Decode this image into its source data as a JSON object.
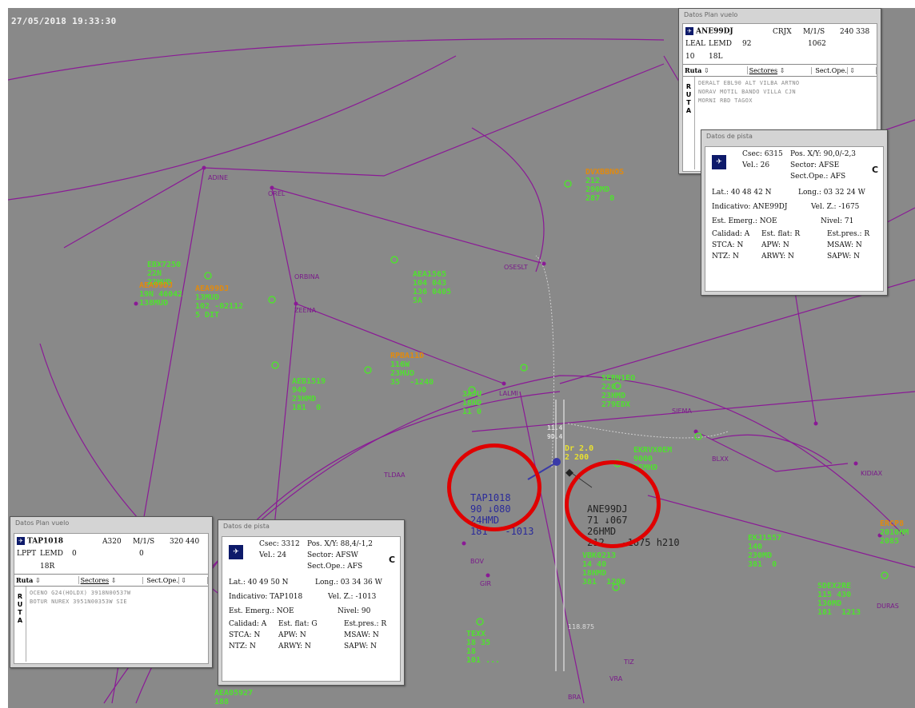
{
  "timestamp": "27/05/2018 19:33:30",
  "colors": {
    "scope_bg": "#898989",
    "route_line": "#8a1a96",
    "track_green": "#50e030",
    "track_orange": "#e08a10",
    "highlight_ring": "#e00000"
  },
  "fixes": [
    "ADINE",
    "OREL",
    "OSESLT",
    "ORBINA",
    "ZEENA",
    "LALMI",
    "TLDAA",
    "SIEMA",
    "BLXX",
    "KIDIAX",
    "BOV",
    "GIR",
    "DURAS",
    "VRA",
    "TIZ",
    "BRA",
    "118.875"
  ],
  "traffic": {
    "t1": [
      "EBX7250",
      "22N",
      "22HUD"
    ],
    "t2": [
      "AEA99DJ",
      "19N 46042",
      "138MUD"
    ],
    "t3": [
      "AEA99DJ",
      "13MUD",
      "102 -02112",
      "5 DIT"
    ],
    "t4": [
      "DVXBBNOS",
      "212",
      "290MD",
      "287  0"
    ],
    "t5": [
      "AEA1565",
      "104 043",
      "136 0405",
      "5A"
    ],
    "t6": [
      "RPBA11D",
      "116W",
      "23HUD",
      "35  -1240"
    ],
    "t7": [
      "AEB1519",
      "940",
      "23HMD",
      "181  0"
    ],
    "t8": [
      "SERN1EO",
      "220",
      "23HMD",
      "279EDX"
    ],
    "t9": [
      "3AJU",
      "18HD",
      "11 0"
    ],
    "t10": [
      "EKRVX0EM",
      "9000",
      "2EMHD"
    ],
    "t11": [
      "EKJ1557",
      "140",
      "230MD",
      "381  0"
    ],
    "t12": [
      "VBK0213",
      "14 40",
      "18HMD",
      "381  1200"
    ],
    "t13": [
      "SDEX2RE",
      "115 430",
      "130MD",
      "181  1213"
    ],
    "t14": [
      "TEXX",
      "18 35",
      "18",
      "101 ..."
    ],
    "t15": [
      "AEA05927",
      "188"
    ],
    "t16": [
      "ERCP8",
      "2010HM",
      "2085"
    ],
    "t17": [
      "Dr 2.0",
      "2 200"
    ],
    "t18": [
      "11.4",
      "9D.4"
    ]
  },
  "tap_label": [
    "TAP1018",
    "90 ↓080",
    "24HMD",
    "181   -1013"
  ],
  "ane_label": [
    "ANE99DJ",
    "71 ↓067",
    "26HMD",
    "212   -1675 h210"
  ],
  "flight_plan_top": {
    "title": "Datos Plan vuelo",
    "callsign": "ANE99DJ",
    "type": "CRJX",
    "wake": "M/1/S",
    "speeds": "240 338",
    "origin": "LEAL",
    "dest": "LEMD",
    "f1": "92",
    "f2": "1062",
    "f3": "10",
    "f4": "18L",
    "ruta_label": "Ruta",
    "sectores_label": "Sectores",
    "sect_ope_label": "Sect.Ope.",
    "ruta_vertical": [
      "R",
      "U",
      "T",
      "A"
    ],
    "route_lines": [
      "DERALT EBL90 ALT VILBA ARTNO",
      "NORAV MOTIL BANDO VILLA CJN",
      "MORNI RBD TAGOX"
    ]
  },
  "track_top": {
    "title": "Datos de pista",
    "csec": "Csec: 6315",
    "pos": "Pos. X/Y: 90,0/-2,3",
    "vel": "Vel.: 26",
    "sector": "Sector: AFSE",
    "sect_ope": "Sect.Ope.: AFS",
    "c": "C",
    "lat": "Lat.: 40 48 42 N",
    "long": "Long.: 03 32 24 W",
    "indicativo": "Indicativo: ANE99DJ",
    "velz": "Vel. Z.: -1675",
    "emerg": "Est. Emerg.: NOE",
    "nivel": "Nivel: 71",
    "calidad": "Calidad: A",
    "est_flat": "Est. flat: R",
    "est_pres": "Est.pres.: R",
    "stca": "STCA: N",
    "apw": "APW: N",
    "msaw": "MSAW: N",
    "ntz": "NTZ: N",
    "arwy": "ARWY: N",
    "sapw": "SAPW: N"
  },
  "flight_plan_bottom": {
    "title": "Datos Plan vuelo",
    "callsign": "TAP1018",
    "type": "A320",
    "wake": "M/1/S",
    "speeds": "320 440",
    "origin": "LPPT",
    "dest": "LEMD",
    "f1": "0",
    "f2": "0",
    "f4": "18R",
    "ruta_label": "Ruta",
    "sectores_label": "Sectores",
    "sect_ope_label": "Sect.Ope.",
    "ruta_vertical": [
      "R",
      "U",
      "T",
      "A"
    ],
    "route_lines": [
      "OCENO G24(HOLDX) 3918N00537W",
      "BOTUR NUREX 3951N00353W SIE"
    ]
  },
  "track_bottom": {
    "title": "Datos de pista",
    "csec": "Csec: 3312",
    "pos": "Pos. X/Y: 88,4/-1,2",
    "vel": "Vel.: 24",
    "sector": "Sector: AFSW",
    "sect_ope": "Sect.Ope.: AFS",
    "c": "C",
    "lat": "Lat.: 40 49 50 N",
    "long": "Long.: 03 34 36 W",
    "indicativo": "Indicativo: TAP1018",
    "velz": "Vel. Z.: -1013",
    "emerg": "Est. Emerg.: NOE",
    "nivel": "Nivel: 90",
    "calidad": "Calidad: A",
    "est_flat": "Est. flat: G",
    "est_pres": "Est.pres.: R",
    "stca": "STCA: N",
    "apw": "APW: N",
    "msaw": "MSAW: N",
    "ntz": "NTZ: N",
    "arwy": "ARWY: N",
    "sapw": "SAPW: N"
  }
}
